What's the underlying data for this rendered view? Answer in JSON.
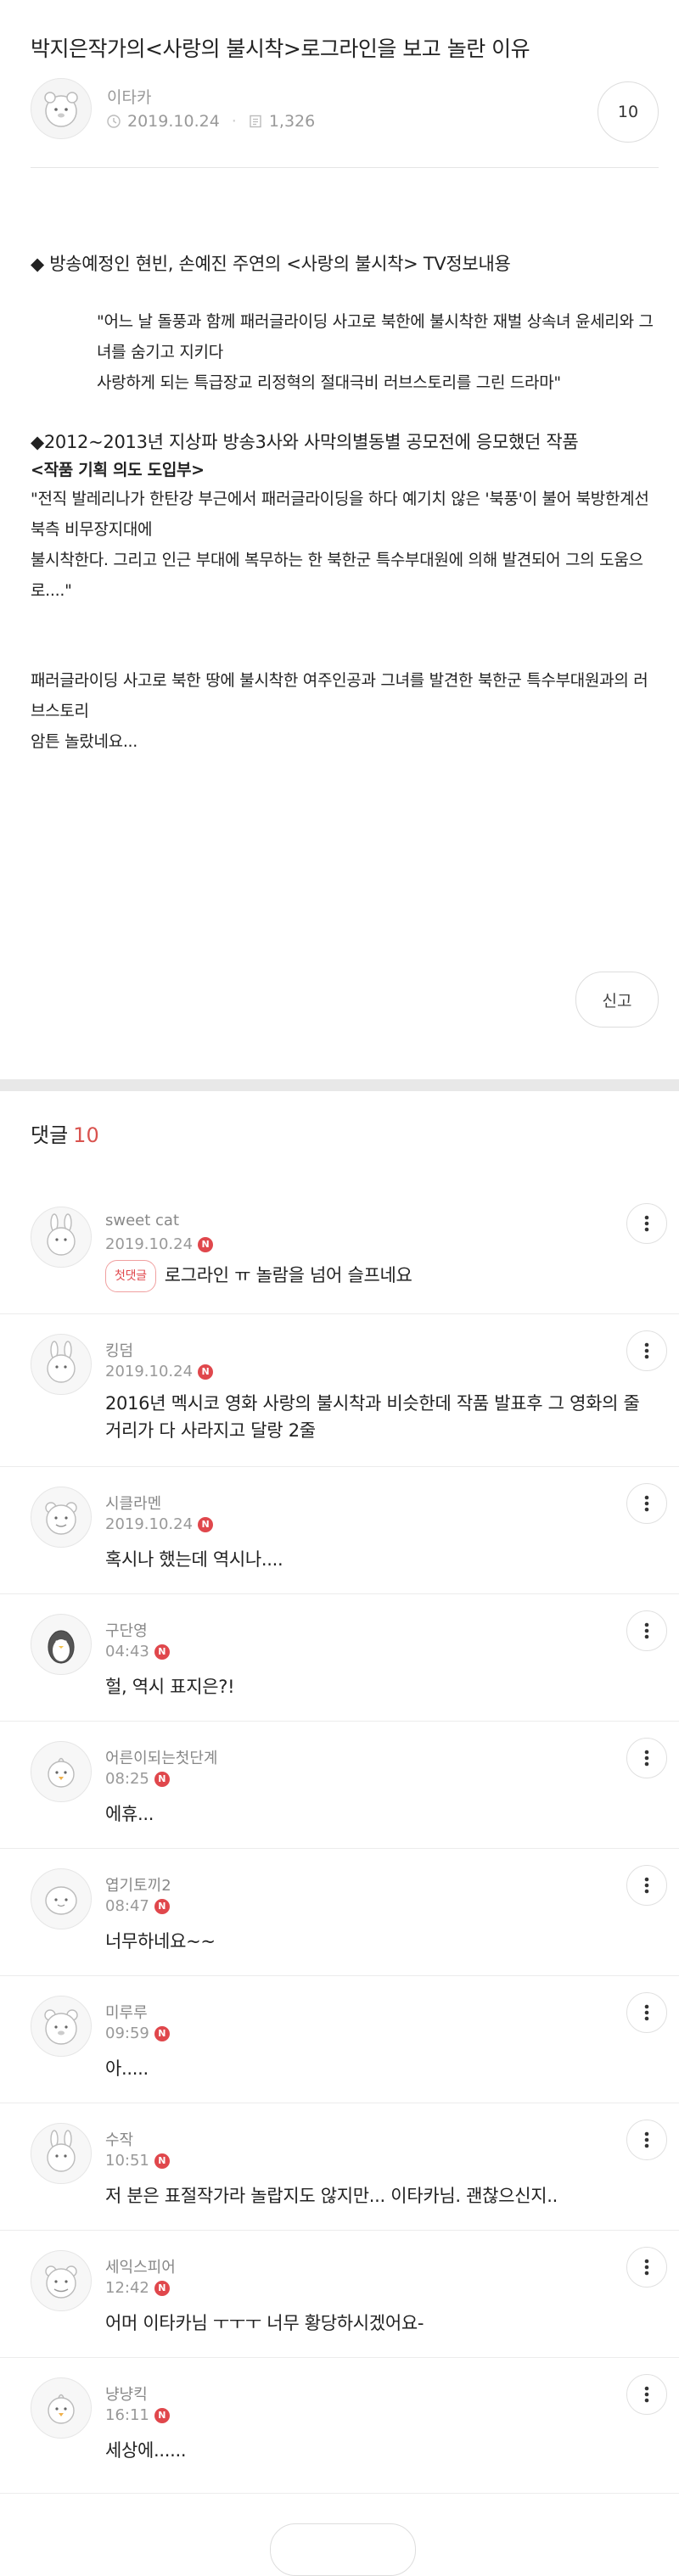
{
  "post": {
    "title": "박지은작가의<사랑의 불시착>로그라인을 보고 놀란 이유",
    "author": "이타카",
    "date": "2019.10.24",
    "views": "1,326",
    "comment_count": "10"
  },
  "content": {
    "line1": "◆ 방송예정인 현빈, 손예진 주연의 <사랑의 불시착> TV정보내용",
    "quote1": "\"어느 날 돌풍과 함께 패러글라이딩 사고로 북한에 불시착한 재벌 상속녀 윤세리와 그녀를 숨기고 지키다",
    "quote2": "사랑하게 되는 특급장교 리정혁의 절대극비 러브스토리를 그린 드라마\"",
    "heading2": "◆2012~2013년  지상파 방송3사와 사막의별동별 공모전에 응모했던 작품",
    "subheading": "<작품 기획 의도 도입부>",
    "para2a": "\"전직 발레리나가 한탄강 부근에서 패러글라이딩을 하다 예기치 않은 '북풍'이 불어 북방한계선 북측 비무장지대에",
    "para2b": " 불시착한다.  그리고 인근 부대에 복무하는 한 북한군 특수부대원에 의해 발견되어 그의 도움으로....\"",
    "para3": "패러글라이딩 사고로 북한 땅에 불시착한 여주인공과 그녀를 발견한 북한군 특수부대원과의 러브스토리",
    "para4": "암튼 놀랐네요..."
  },
  "report_label": "신고",
  "comments_header": {
    "label": "댓글",
    "count": "10"
  },
  "comments": [
    {
      "name": "sweet cat",
      "time": "2019.10.24",
      "badge": "첫댓글",
      "text": "로그라인 ㅠ 놀람을 넘어 슬프네요"
    },
    {
      "name": "킹덤",
      "time": "2019.10.24",
      "text": "2016년 멕시코 영화 사랑의 불시착과 비슷한데 작품 발표후 그 영화의 줄거리가 다 사라지고 달랑 2줄"
    },
    {
      "name": "시클라멘",
      "time": "2019.10.24",
      "text": "혹시나 했는데 역시나...."
    },
    {
      "name": "구단영",
      "time": "04:43",
      "text": "헐, 역시 표지은?!"
    },
    {
      "name": "어른이되는첫단계",
      "time": "08:25",
      "text": "에휴..."
    },
    {
      "name": "엽기토끼2",
      "time": "08:47",
      "text": "너무하네요~~"
    },
    {
      "name": "미루루",
      "time": "09:59",
      "text": "아....."
    },
    {
      "name": "수작",
      "time": "10:51",
      "text": "저 분은 표절작가라 놀랍지도 않지만... 이타카님. 괜찮으신지.."
    },
    {
      "name": "세익스피어",
      "time": "12:42",
      "text": "어머 이타카님 ㅜㅜㅜ 너무 황당하시겠어요-"
    },
    {
      "name": "냥냥킥",
      "time": "16:11",
      "text": "세상에......"
    }
  ],
  "new_badge": "N",
  "icons": {
    "clock": "clock-icon",
    "document": "document-icon",
    "more": "more-vertical-icon"
  }
}
